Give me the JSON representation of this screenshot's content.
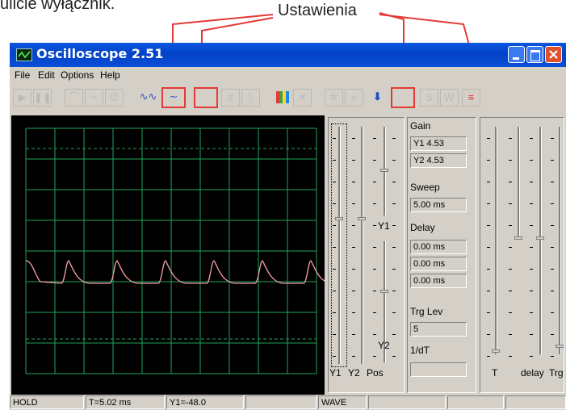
{
  "caption": {
    "top_text": "ulicie wyłącznik.",
    "settings_label": "Ustawienia"
  },
  "window": {
    "title": "Oscilloscope 2.51"
  },
  "menu": [
    "File",
    "Edit",
    "Options",
    "Help"
  ],
  "panel": {
    "gain_label": "Gain",
    "y1_gain": "Y1  4.53",
    "y2_gain": "Y2  4.53",
    "sweep_label": "Sweep",
    "sweep_value": "5.00 ms",
    "delay_label": "Delay",
    "delay_values": [
      "0.00 ms",
      "0.00 ms",
      "0.00 ms"
    ],
    "trg_label": "Trg Lev",
    "trg_value": "5",
    "dt_label": "1/dT",
    "dt_value": "",
    "y1_mark": "Y1",
    "y2_mark": "Y2",
    "bottom_left": [
      "Y1",
      "Y2",
      "Pos"
    ],
    "bottom_right": [
      "T",
      "delay",
      "Trg"
    ]
  },
  "status": [
    "HOLD",
    "T=5.02 ms",
    "Y1=-48.0",
    "",
    "WAVE",
    "",
    "",
    ""
  ],
  "colors": {
    "title_bar": "#0a4ed8",
    "scope_bg": "#000000",
    "grid": "#1fa55a",
    "trace": "#f5a0a8",
    "annotation": "#e53935",
    "window_face": "#d4d0c8"
  },
  "icons": [
    "play-icon",
    "pause-icon",
    "zoom-icon",
    "wave-icon",
    "circle-icon",
    "meander-icon",
    "sine-icon",
    "blank-icon",
    "grid-icon",
    "single-icon",
    "color-bars-icon",
    "x-icon",
    "sparkle-icon",
    "measure-icon",
    "down-arrow-icon",
    "blank-settings-icon",
    "s-icon",
    "w-icon",
    "marker-icon"
  ]
}
